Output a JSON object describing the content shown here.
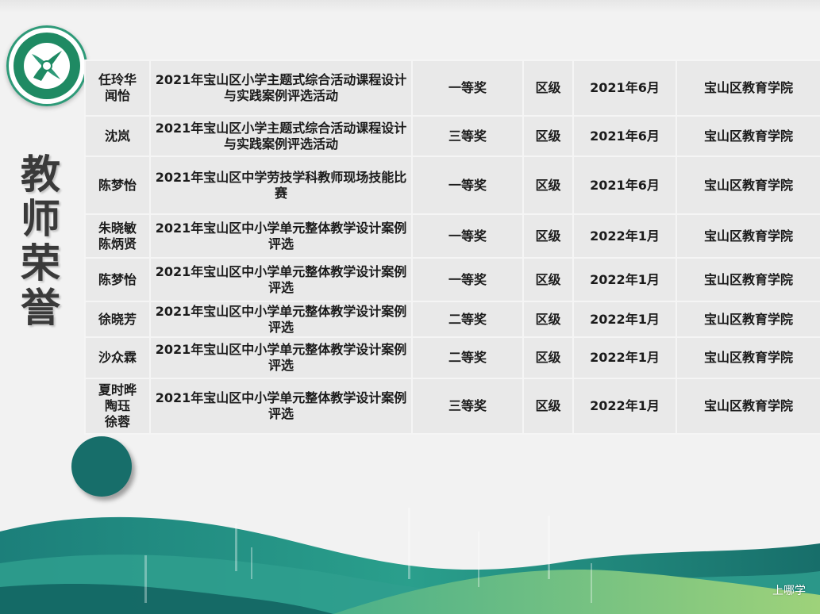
{
  "sidebar": {
    "title_chars": [
      "教",
      "师",
      "荣",
      "誉"
    ]
  },
  "awards": [
    {
      "names": [
        "任玲华",
        "闻怡"
      ],
      "event": "2021年宝山区小学主题式综合活动课程设计与实践案例评选活动",
      "level": "一等奖",
      "scope": "区级",
      "date": "2021年6月",
      "issuer": "宝山区教育学院"
    },
    {
      "names": [
        "沈岚"
      ],
      "event": "2021年宝山区小学主题式综合活动课程设计与实践案例评选活动",
      "level": "三等奖",
      "scope": "区级",
      "date": "2021年6月",
      "issuer": "宝山区教育学院"
    },
    {
      "names": [
        "陈梦怡"
      ],
      "event": "2021年宝山区中学劳技学科教师现场技能比赛",
      "level": "一等奖",
      "scope": "区级",
      "date": "2021年6月",
      "issuer": "宝山区教育学院"
    },
    {
      "names": [
        "朱晓敏",
        "陈炳贤"
      ],
      "event": "2021年宝山区中小学单元整体教学设计案例评选",
      "level": "一等奖",
      "scope": "区级",
      "date": "2022年1月",
      "issuer": "宝山区教育学院"
    },
    {
      "names": [
        "陈梦怡"
      ],
      "event": "2021年宝山区中小学单元整体教学设计案例评选",
      "level": "一等奖",
      "scope": "区级",
      "date": "2022年1月",
      "issuer": "宝山区教育学院"
    },
    {
      "names": [
        "徐晓芳"
      ],
      "event": "2021年宝山区中小学单元整体教学设计案例评选",
      "level": "二等奖",
      "scope": "区级",
      "date": "2022年1月",
      "issuer": "宝山区教育学院"
    },
    {
      "names": [
        "沙众霖"
      ],
      "event": "2021年宝山区中小学单元整体教学设计案例评选",
      "level": "二等奖",
      "scope": "区级",
      "date": "2022年1月",
      "issuer": "宝山区教育学院"
    },
    {
      "names": [
        "夏时晔",
        "陶珏",
        "徐蓉"
      ],
      "event": "2021年宝山区中小学单元整体教学设计案例评选",
      "level": "三等奖",
      "scope": "区级",
      "date": "2022年1月",
      "issuer": "宝山区教育学院"
    }
  ],
  "watermark": "上哪学",
  "colors": {
    "teal_dark": "#176e6a",
    "logo_green": "#1f8a63",
    "cell_bg": "#e9e9e9"
  }
}
